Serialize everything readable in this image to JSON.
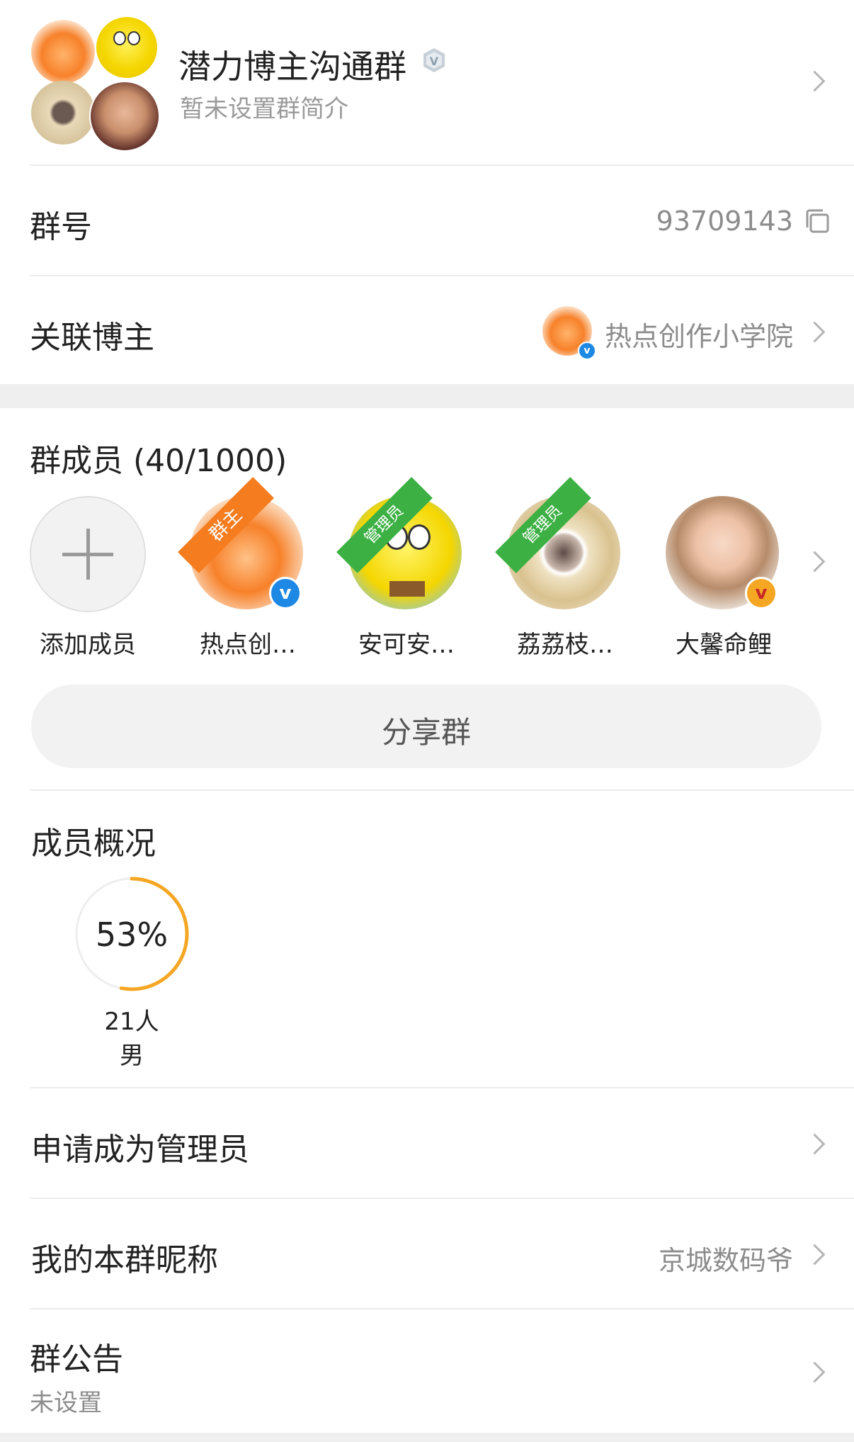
{
  "group": {
    "name": "潜力博主沟通群",
    "intro": "暂未设置群简介",
    "id_label": "群号",
    "id_value": "93709143",
    "linked_label": "关联博主",
    "linked_name": "热点创作小学院"
  },
  "members": {
    "title": "群成员 (40/1000)",
    "add_label": "添加成员",
    "list": [
      {
        "name": "热点创…",
        "badge": "群主",
        "badge_color": "#f57c1f"
      },
      {
        "name": "安可安…",
        "badge": "管理员",
        "badge_color": "#3cb043"
      },
      {
        "name": "荔荔枝…",
        "badge": "管理员",
        "badge_color": "#3cb043"
      },
      {
        "name": "大馨命鲤",
        "badge": ""
      }
    ],
    "share_label": "分享群"
  },
  "overview": {
    "title": "成员概况",
    "percent_label": "53%",
    "percent": 0.53,
    "count_label": "21人",
    "gender_label": "男"
  },
  "rows": {
    "apply_admin": "申请成为管理员",
    "nickname_label": "我的本群昵称",
    "nickname_value": "京城数码爷",
    "notice_label": "群公告",
    "notice_value": "未设置"
  },
  "colors": {
    "accent_orange": "#f5a623",
    "verified_blue": "#1e88e5",
    "gold_badge": "#f5a623"
  }
}
